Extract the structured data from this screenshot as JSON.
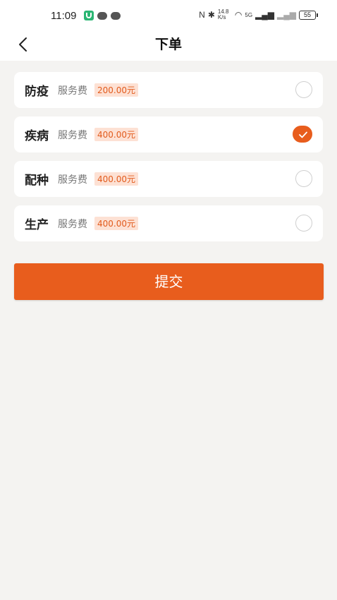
{
  "status_bar": {
    "time": "11:09",
    "net_speed": "14.8 K/s",
    "signal_label": "5G",
    "battery": "55"
  },
  "header": {
    "title": "下单"
  },
  "options": [
    {
      "name": "防疫",
      "fee_label": "服务费",
      "price": "200.00元",
      "selected": false
    },
    {
      "name": "疾病",
      "fee_label": "服务费",
      "price": "400.00元",
      "selected": true
    },
    {
      "name": "配种",
      "fee_label": "服务费",
      "price": "400.00元",
      "selected": false
    },
    {
      "name": "生产",
      "fee_label": "服务费",
      "price": "400.00元",
      "selected": false
    }
  ],
  "submit": {
    "label": "提交"
  },
  "colors": {
    "accent": "#e85d1d",
    "price_bg": "#fde1d4",
    "page_bg": "#f4f3f1"
  }
}
